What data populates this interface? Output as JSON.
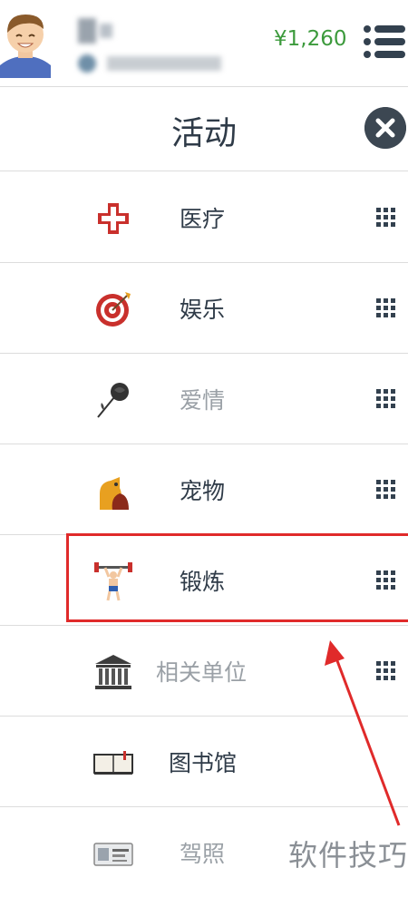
{
  "header": {
    "balance": "¥1,260",
    "menu_icon": "hamburger-list-icon",
    "avatar_icon": "user-avatar"
  },
  "panel": {
    "title": "活动",
    "close_icon": "close-icon"
  },
  "activities": [
    {
      "label": "医疗",
      "icon": "medical-cross-icon",
      "muted": false
    },
    {
      "label": "娱乐",
      "icon": "target-icon",
      "muted": false
    },
    {
      "label": "爱情",
      "icon": "rose-icon",
      "muted": true
    },
    {
      "label": "宠物",
      "icon": "dog-icon",
      "muted": false
    },
    {
      "label": "锻炼",
      "icon": "weightlifter-icon",
      "muted": false
    },
    {
      "label": "相关单位",
      "icon": "institution-icon",
      "muted": true
    },
    {
      "label": "图书馆",
      "icon": "book-icon",
      "muted": false
    },
    {
      "label": "驾照",
      "icon": "license-card-icon",
      "muted": true
    }
  ],
  "watermark": "软件技巧",
  "colors": {
    "accent_green": "#3c9a3c",
    "dark": "#2f3b48",
    "highlight_red": "#e02a2a"
  }
}
